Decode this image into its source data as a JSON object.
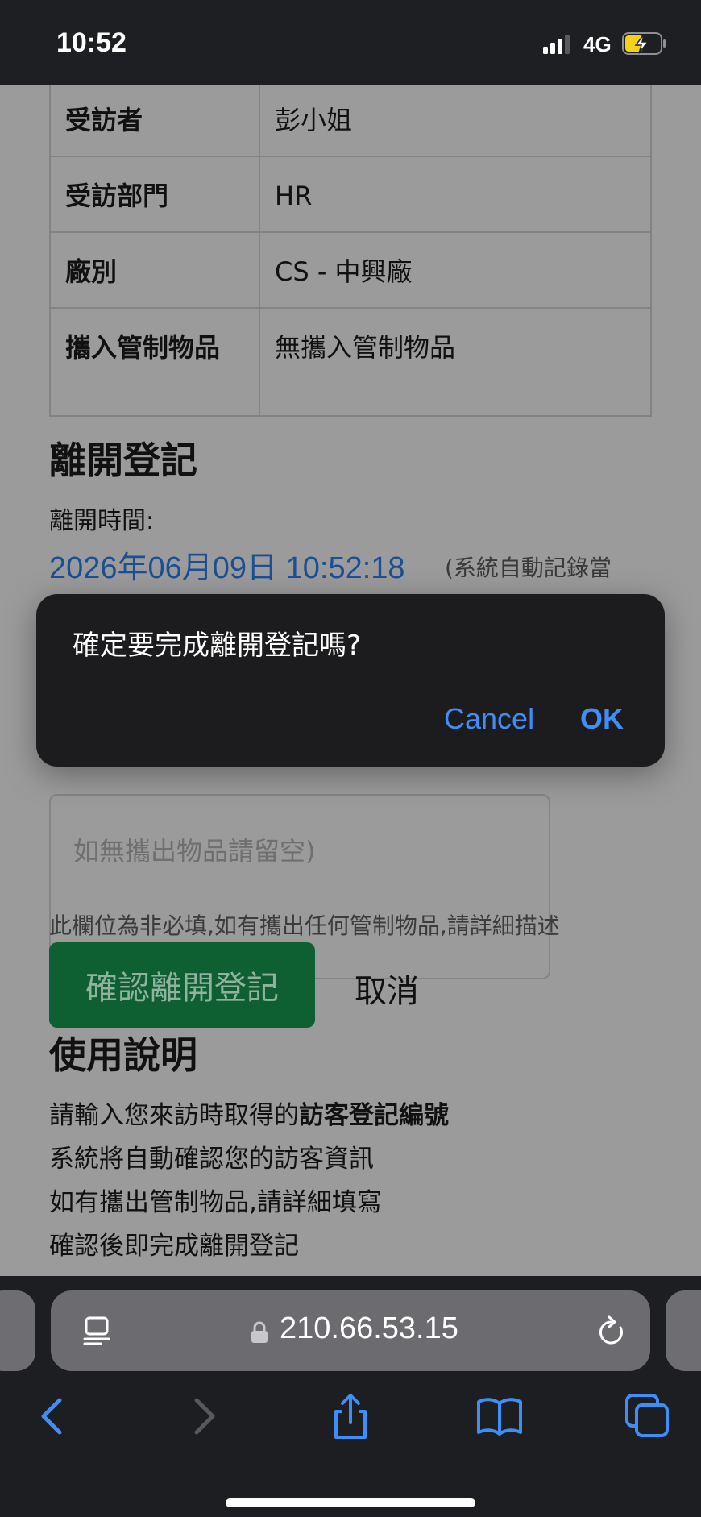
{
  "status_bar": {
    "time": "10:52",
    "network": "4G"
  },
  "info_table": [
    {
      "key": "受訪者",
      "value": "彭小姐"
    },
    {
      "key": "受訪部門",
      "value": "HR"
    },
    {
      "key": "廠別",
      "value": "CS - 中興廠"
    },
    {
      "key": "攜入管制物品",
      "value": "無攜入管制物品"
    }
  ],
  "leave_section": {
    "title": "離開登記",
    "time_label": "離開時間:",
    "time_value": "2026年06月09日 10:52:18",
    "time_note": "(系統自動記錄當",
    "textarea_placeholder": "如無攜出物品請留空)",
    "help_text": "此欄位為非必填,如有攜出任何管制物品,請詳細描述",
    "confirm_button": "確認離開登記",
    "cancel_link": "取消"
  },
  "instructions": {
    "title": "使用說明",
    "line1_prefix": "請輸入您來訪時取得的",
    "line1_bold": "訪客登記編號",
    "line2": "系統將自動確認您的訪客資訊",
    "line3": "如有攜出管制物品,請詳細填寫",
    "line4": "確認後即完成離開登記"
  },
  "dialog": {
    "message": "確定要完成離開登記嗎?",
    "cancel_label": "Cancel",
    "ok_label": "OK"
  },
  "browser": {
    "url": "210.66.53.15",
    "toolbar_icons": [
      "back-icon",
      "forward-icon",
      "share-icon",
      "bookmarks-icon",
      "tabs-icon"
    ]
  },
  "colors": {
    "accent_blue": "#3f8df6",
    "confirm_green": "#0e6033",
    "time_blue": "#1b4f96",
    "battery_yellow": "#f5d21a"
  }
}
